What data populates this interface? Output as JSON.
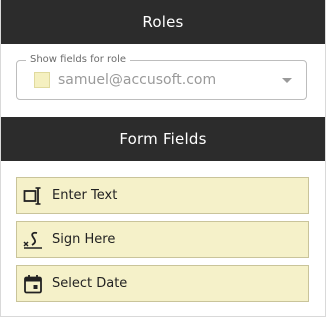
{
  "roles": {
    "title": "Roles",
    "select": {
      "legend": "Show fields for role",
      "value": "samuel@accusoft.com",
      "swatch_color": "#f5f0c0"
    }
  },
  "form_fields": {
    "title": "Form Fields",
    "items": [
      {
        "label": "Enter Text",
        "icon": "text-field-icon"
      },
      {
        "label": "Sign Here",
        "icon": "signature-icon"
      },
      {
        "label": "Select Date",
        "icon": "calendar-icon"
      }
    ]
  }
}
